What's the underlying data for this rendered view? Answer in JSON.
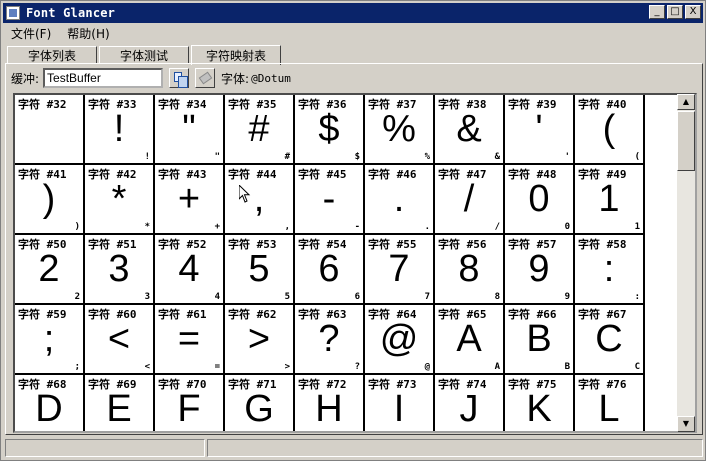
{
  "window": {
    "title": "Font Glancer"
  },
  "title_buttons": [
    "_",
    "□",
    "X"
  ],
  "menu": [
    {
      "label": "文件(F)"
    },
    {
      "label": "帮助(H)"
    }
  ],
  "tabs": [
    {
      "label": "字体列表"
    },
    {
      "label": "字体测试"
    },
    {
      "label": "字符映射表"
    }
  ],
  "buffer": {
    "label": "缓冲:",
    "value": "TestBuffer"
  },
  "font": {
    "label": "字体:",
    "value": "@Dotum"
  },
  "cells": [
    {
      "label": "字符 #32",
      "glyph": " ",
      "small": " "
    },
    {
      "label": "字符 #33",
      "glyph": "!",
      "small": "!"
    },
    {
      "label": "字符 #34",
      "glyph": "\"",
      "small": "\""
    },
    {
      "label": "字符 #35",
      "glyph": "#",
      "small": "#"
    },
    {
      "label": "字符 #36",
      "glyph": "$",
      "small": "$"
    },
    {
      "label": "字符 #37",
      "glyph": "%",
      "small": "%"
    },
    {
      "label": "字符 #38",
      "glyph": "&",
      "small": "&"
    },
    {
      "label": "字符 #39",
      "glyph": "'",
      "small": "'"
    },
    {
      "label": "字符 #40",
      "glyph": "(",
      "small": "("
    },
    {
      "label": "字符 #41",
      "glyph": ")",
      "small": ")"
    },
    {
      "label": "字符 #42",
      "glyph": "*",
      "small": "*"
    },
    {
      "label": "字符 #43",
      "glyph": "+",
      "small": "+"
    },
    {
      "label": "字符 #44",
      "glyph": ",",
      "small": ","
    },
    {
      "label": "字符 #45",
      "glyph": "-",
      "small": "-"
    },
    {
      "label": "字符 #46",
      "glyph": ".",
      "small": "."
    },
    {
      "label": "字符 #47",
      "glyph": "/",
      "small": "/"
    },
    {
      "label": "字符 #48",
      "glyph": "0",
      "small": "0"
    },
    {
      "label": "字符 #49",
      "glyph": "1",
      "small": "1"
    },
    {
      "label": "字符 #50",
      "glyph": "2",
      "small": "2"
    },
    {
      "label": "字符 #51",
      "glyph": "3",
      "small": "3"
    },
    {
      "label": "字符 #52",
      "glyph": "4",
      "small": "4"
    },
    {
      "label": "字符 #53",
      "glyph": "5",
      "small": "5"
    },
    {
      "label": "字符 #54",
      "glyph": "6",
      "small": "6"
    },
    {
      "label": "字符 #55",
      "glyph": "7",
      "small": "7"
    },
    {
      "label": "字符 #56",
      "glyph": "8",
      "small": "8"
    },
    {
      "label": "字符 #57",
      "glyph": "9",
      "small": "9"
    },
    {
      "label": "字符 #58",
      "glyph": ":",
      "small": ":"
    },
    {
      "label": "字符 #59",
      "glyph": ";",
      "small": ";"
    },
    {
      "label": "字符 #60",
      "glyph": "<",
      "small": "<"
    },
    {
      "label": "字符 #61",
      "glyph": "=",
      "small": "="
    },
    {
      "label": "字符 #62",
      "glyph": ">",
      "small": ">"
    },
    {
      "label": "字符 #63",
      "glyph": "?",
      "small": "?"
    },
    {
      "label": "字符 #64",
      "glyph": "@",
      "small": "@"
    },
    {
      "label": "字符 #65",
      "glyph": "A",
      "small": "A"
    },
    {
      "label": "字符 #66",
      "glyph": "B",
      "small": "B"
    },
    {
      "label": "字符 #67",
      "glyph": "C",
      "small": "C"
    },
    {
      "label": "字符 #68",
      "glyph": "D",
      "small": ""
    },
    {
      "label": "字符 #69",
      "glyph": "E",
      "small": ""
    },
    {
      "label": "字符 #70",
      "glyph": "F",
      "small": ""
    },
    {
      "label": "字符 #71",
      "glyph": "G",
      "small": ""
    },
    {
      "label": "字符 #72",
      "glyph": "H",
      "small": ""
    },
    {
      "label": "字符 #73",
      "glyph": "I",
      "small": ""
    },
    {
      "label": "字符 #74",
      "glyph": "J",
      "small": ""
    },
    {
      "label": "字符 #75",
      "glyph": "K",
      "small": ""
    },
    {
      "label": "字符 #76",
      "glyph": "L",
      "small": ""
    }
  ],
  "scrollbar": {
    "up_icon": "arrow-up-icon",
    "down_icon": "arrow-down-icon"
  },
  "colors": {
    "titlebar": "#0a246a",
    "face": "#d4d0c8",
    "grid_line": "#000000"
  }
}
